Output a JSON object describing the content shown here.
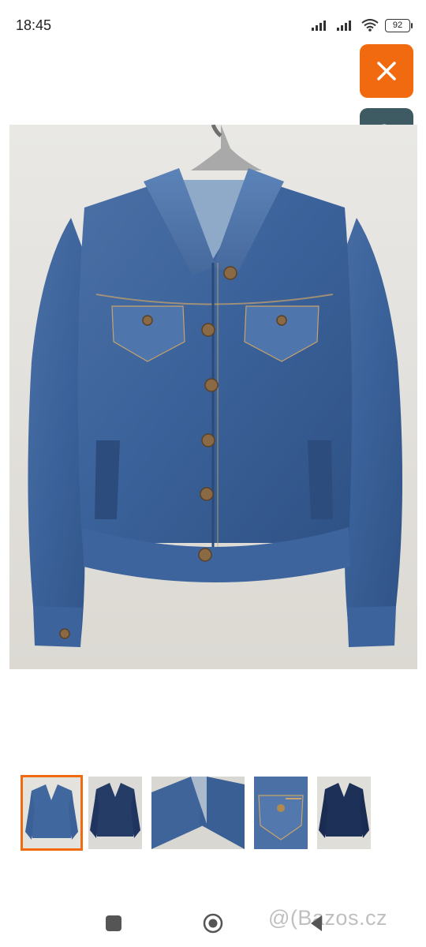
{
  "status_bar": {
    "time": "18:45",
    "battery": "92",
    "icons": [
      "signal-icon",
      "signal-icon",
      "wifi-icon",
      "battery-icon"
    ]
  },
  "actions": {
    "close_icon": "close-icon",
    "zoom_icon": "zoom-in-icon",
    "accent_color": "#f26a10",
    "zoom_color": "#3e5a63"
  },
  "gallery": {
    "thumbnail_count": 5,
    "selected_index": 0
  },
  "navigation": {
    "icons": [
      "recents-icon",
      "home-icon",
      "back-icon"
    ]
  },
  "watermark": {
    "text": "@(Bazos.cz"
  }
}
